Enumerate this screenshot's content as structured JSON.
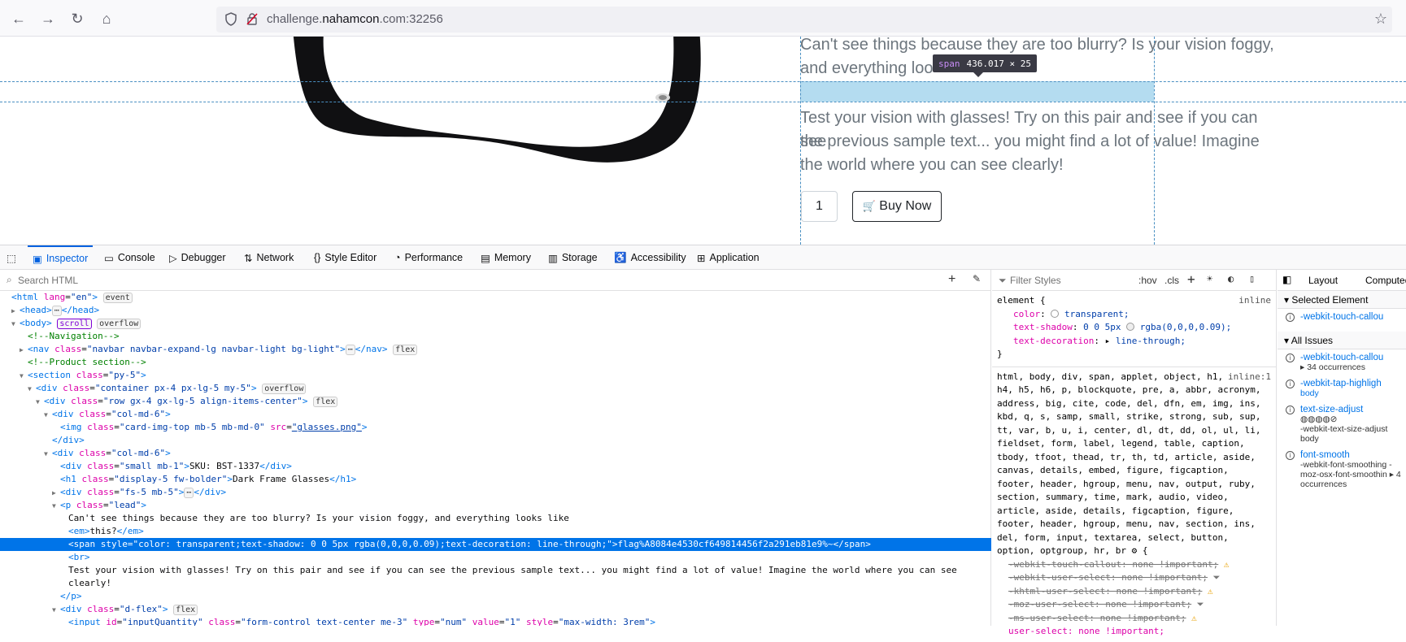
{
  "browser": {
    "url_prefix": "challenge.",
    "url_host": "nahamcon",
    "url_suffix": ".com:32256"
  },
  "page": {
    "lead_line1": "Can't see things because they are too blurry? Is your vision foggy,",
    "lead_line2": "and everything loo",
    "para2_line1": "Test your vision with glasses! Try on this pair and see if you can see",
    "para2_line2": "the previous sample text... you might find a lot of value! Imagine",
    "para2_line3": "the world where you can see clearly!",
    "quantity": "1",
    "buy_label": "Buy Now",
    "tooltip_tag": "span",
    "tooltip_size": "436.017 × 25"
  },
  "devtools": {
    "tabs": [
      "Inspector",
      "Console",
      "Debugger",
      "Network",
      "Style Editor",
      "Performance",
      "Memory",
      "Storage",
      "Accessibility",
      "Application"
    ],
    "search_placeholder": "Search HTML",
    "filter_placeholder": "Filter Styles",
    "hov": ":hov",
    "cls": ".cls",
    "side_tabs": [
      "Layout",
      "Computed"
    ],
    "tree": [
      {
        "indent": 0,
        "html": "<span class='t'>&lt;html</span> <span class='an'>lang</span>=<span class='av'>\"en\"</span><span class='t'>&gt;</span> <span class='badge'>event</span>"
      },
      {
        "indent": 1,
        "tw": "▶",
        "html": "<span class='t'>&lt;head&gt;</span><span class='badge'>⋯</span><span class='t'>&lt;/head&gt;</span>"
      },
      {
        "indent": 1,
        "tw": "▼",
        "html": "<span class='t'>&lt;body&gt;</span> <span class='badge' style='color:#8000d7;border-color:#8000d7'>scroll</span> <span class='badge'>overflow</span>"
      },
      {
        "indent": 2,
        "html": "<span class='cm'>&lt;!--Navigation--&gt;</span>"
      },
      {
        "indent": 2,
        "tw": "▶",
        "html": "<span class='t'>&lt;nav</span> <span class='an'>class</span>=<span class='av'>\"navbar navbar-expand-lg navbar-light bg-light\"</span><span class='t'>&gt;</span><span class='badge'>⋯</span><span class='t'>&lt;/nav&gt;</span> <span class='badge'>flex</span>"
      },
      {
        "indent": 2,
        "html": "<span class='cm'>&lt;!--Product section--&gt;</span>"
      },
      {
        "indent": 2,
        "tw": "▼",
        "html": "<span class='t'>&lt;section</span> <span class='an'>class</span>=<span class='av'>\"py-5\"</span><span class='t'>&gt;</span>"
      },
      {
        "indent": 3,
        "tw": "▼",
        "html": "<span class='t'>&lt;div</span> <span class='an'>class</span>=<span class='av'>\"container px-4 px-lg-5 my-5\"</span><span class='t'>&gt;</span> <span class='badge'>overflow</span>"
      },
      {
        "indent": 4,
        "tw": "▼",
        "html": "<span class='t'>&lt;div</span> <span class='an'>class</span>=<span class='av'>\"row gx-4 gx-lg-5 align-items-center\"</span><span class='t'>&gt;</span> <span class='badge'>flex</span>"
      },
      {
        "indent": 5,
        "tw": "▼",
        "html": "<span class='t'>&lt;div</span> <span class='an'>class</span>=<span class='av'>\"col-md-6\"</span><span class='t'>&gt;</span>"
      },
      {
        "indent": 6,
        "html": "<span class='t'>&lt;img</span> <span class='an'>class</span>=<span class='av'>\"card-img-top mb-5 mb-md-0\"</span> <span class='an'>src</span>=<span class='av' style='text-decoration:underline'>\"glasses.png\"</span><span class='t'>&gt;</span>"
      },
      {
        "indent": 5,
        "html": "<span class='t'>&lt;/div&gt;</span>"
      },
      {
        "indent": 5,
        "tw": "▼",
        "html": "<span class='t'>&lt;div</span> <span class='an'>class</span>=<span class='av'>\"col-md-6\"</span><span class='t'>&gt;</span>"
      },
      {
        "indent": 6,
        "html": "<span class='t'>&lt;div</span> <span class='an'>class</span>=<span class='av'>\"small mb-1\"</span><span class='t'>&gt;</span>SKU: BST-1337<span class='t'>&lt;/div&gt;</span>"
      },
      {
        "indent": 6,
        "html": "<span class='t'>&lt;h1</span> <span class='an'>class</span>=<span class='av'>\"display-5 fw-bolder\"</span><span class='t'>&gt;</span>Dark Frame Glasses<span class='t'>&lt;/h1&gt;</span>"
      },
      {
        "indent": 6,
        "tw": "▶",
        "html": "<span class='t'>&lt;div</span> <span class='an'>class</span>=<span class='av'>\"fs-5 mb-5\"</span><span class='t'>&gt;</span><span class='badge'>⋯</span><span class='t'>&lt;/div&gt;</span>"
      },
      {
        "indent": 6,
        "tw": "▼",
        "html": "<span class='t'>&lt;p</span> <span class='an'>class</span>=<span class='av'>\"lead\"</span><span class='t'>&gt;</span>"
      },
      {
        "indent": 7,
        "html": "Can't see things because they are too blurry? Is your vision foggy, and everything looks like"
      },
      {
        "indent": 7,
        "html": "<span class='t'>&lt;em&gt;</span>this?<span class='t'>&lt;/em&gt;</span>"
      },
      {
        "indent": 7,
        "sel": true,
        "html": "<span class='t'>&lt;span</span> <span class='an'>style</span>=<span class='av'>\"color: transparent;text-shadow: 0 0 5px rgba(0,0,0,0.09);text-decoration: line-through;\"</span><span class='t'>&gt;</span>flag%A8084e4530cf649814456f2a291eb81e9%~<span class='t'>&lt;/span&gt;</span>"
      },
      {
        "indent": 7,
        "html": "<span class='t'>&lt;br&gt;</span>"
      },
      {
        "indent": 7,
        "html": "Test your vision with glasses! Try on this pair and see if you can see the previous sample text... you might find a lot of value! Imagine the world where you can see"
      },
      {
        "indent": 7,
        "html": "clearly!"
      },
      {
        "indent": 6,
        "html": "<span class='t'>&lt;/p&gt;</span>"
      },
      {
        "indent": 6,
        "tw": "▼",
        "html": "<span class='t'>&lt;div</span> <span class='an'>class</span>=<span class='av'>\"d-flex\"</span><span class='t'>&gt;</span> <span class='badge'>flex</span>"
      },
      {
        "indent": 7,
        "html": "<span class='t'>&lt;input</span> <span class='an'>id</span>=<span class='av'>\"inputQuantity\"</span> <span class='an'>class</span>=<span class='av'>\"form-control text-center me-3\"</span> <span class='an'>type</span>=<span class='av'>\"num\"</span> <span class='an'>value</span>=<span class='av'>\"1\"</span> <span class='an'>style</span>=<span class='av'>\"max-width: 3rem\"</span><span class='t'>&gt;</span>"
      }
    ],
    "rules": {
      "element_selector": "element {",
      "inline": "inline",
      "decls": [
        {
          "name": "color",
          "value": "transparent;"
        },
        {
          "name": "text-shadow",
          "value": "0 0 5px rgba(0,0,0,0.09);"
        },
        {
          "name": "text-decoration",
          "value": "line-through;"
        }
      ],
      "close": "}",
      "selector_list": "html, body, div, span, applet, object, h1, h2, h3, h4, h5, h6, p, blockquote, pre, a, abbr, acronym, address, big, cite, code, del, dfn, em, img, ins, kbd, q, s, samp, small, strike, strong, sub, sup, tt, var, b, u, i, center, dl, dt, dd, ol, ul, li, fieldset, form, label, legend, table, caption, tbody, tfoot, thead, tr, th, td, article, aside, canvas, details, embed, figure, figcaption, footer, header, hgroup, menu, nav, output, ruby, section, summary, time, mark, audio, video, article, aside, details, figcaption, figure, footer, header, hgroup, menu, nav, section, ins, del, form, input, textarea, select, button, option, optgroup, hr, br",
      "selector_source": "inline:1",
      "struck": [
        "-webkit-touch-callout: none !important;",
        "-webkit-user-select: none !important;",
        "-khtml-user-select: none !important;",
        "-moz-user-select: none !important;",
        "-ms-user-select: none !important;"
      ],
      "last": "user-select: none !important;"
    },
    "side": {
      "selected_element": "Selected Element",
      "all_issues": "All Issues",
      "issues": [
        {
          "name": "-webkit-touch-callou",
          "sub": ""
        },
        {
          "name": "-webkit-touch-callou",
          "sub": "▸ 34 occurrences"
        },
        {
          "name": "-webkit-tap-highligh",
          "sub": "body"
        },
        {
          "name": "text-size-adjust",
          "sub": "-webkit-text-size-adjust body"
        },
        {
          "name": "font-smooth",
          "sub": "-webkit-font-smoothing -moz-osx-font-smoothin ▸ 4 occurrences"
        }
      ]
    }
  }
}
